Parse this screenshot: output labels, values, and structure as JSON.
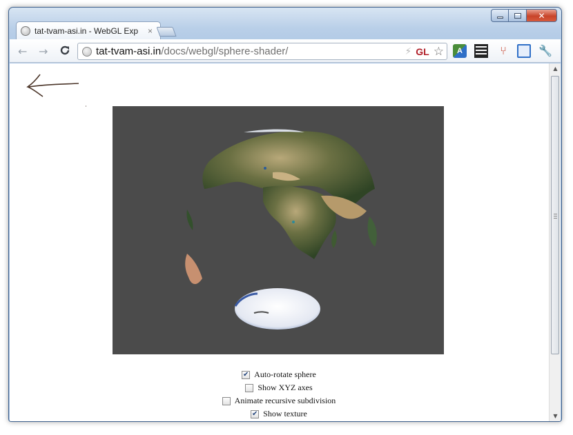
{
  "window": {
    "controls": {
      "minimize": "minimize",
      "maximize": "maximize",
      "close": "✕"
    }
  },
  "tab": {
    "title": "tat-tvam-asi.in - WebGL Exp",
    "close_symbol": "×"
  },
  "toolbar": {
    "back_symbol": "←",
    "forward_symbol": "→",
    "reload_symbol": "C",
    "url_host": "tat-tvam-asi.in",
    "url_path": "/docs/webgl/sphere-shader/",
    "gl_badge": "GL",
    "star_symbol": "☆",
    "extensions": [
      "translate-icon",
      "qr-code-icon",
      "fork-icon",
      "fullscreen-icon",
      "wrench-icon"
    ]
  },
  "controls": [
    {
      "label": "Auto-rotate sphere",
      "checked": true
    },
    {
      "label": "Show XYZ axes",
      "checked": false
    },
    {
      "label": "Animate recursive subdivision",
      "checked": false
    },
    {
      "label": "Show texture",
      "checked": true
    }
  ],
  "colors": {
    "canvas_background": "#4b4b4b",
    "checkbox_check": "#24457c"
  }
}
